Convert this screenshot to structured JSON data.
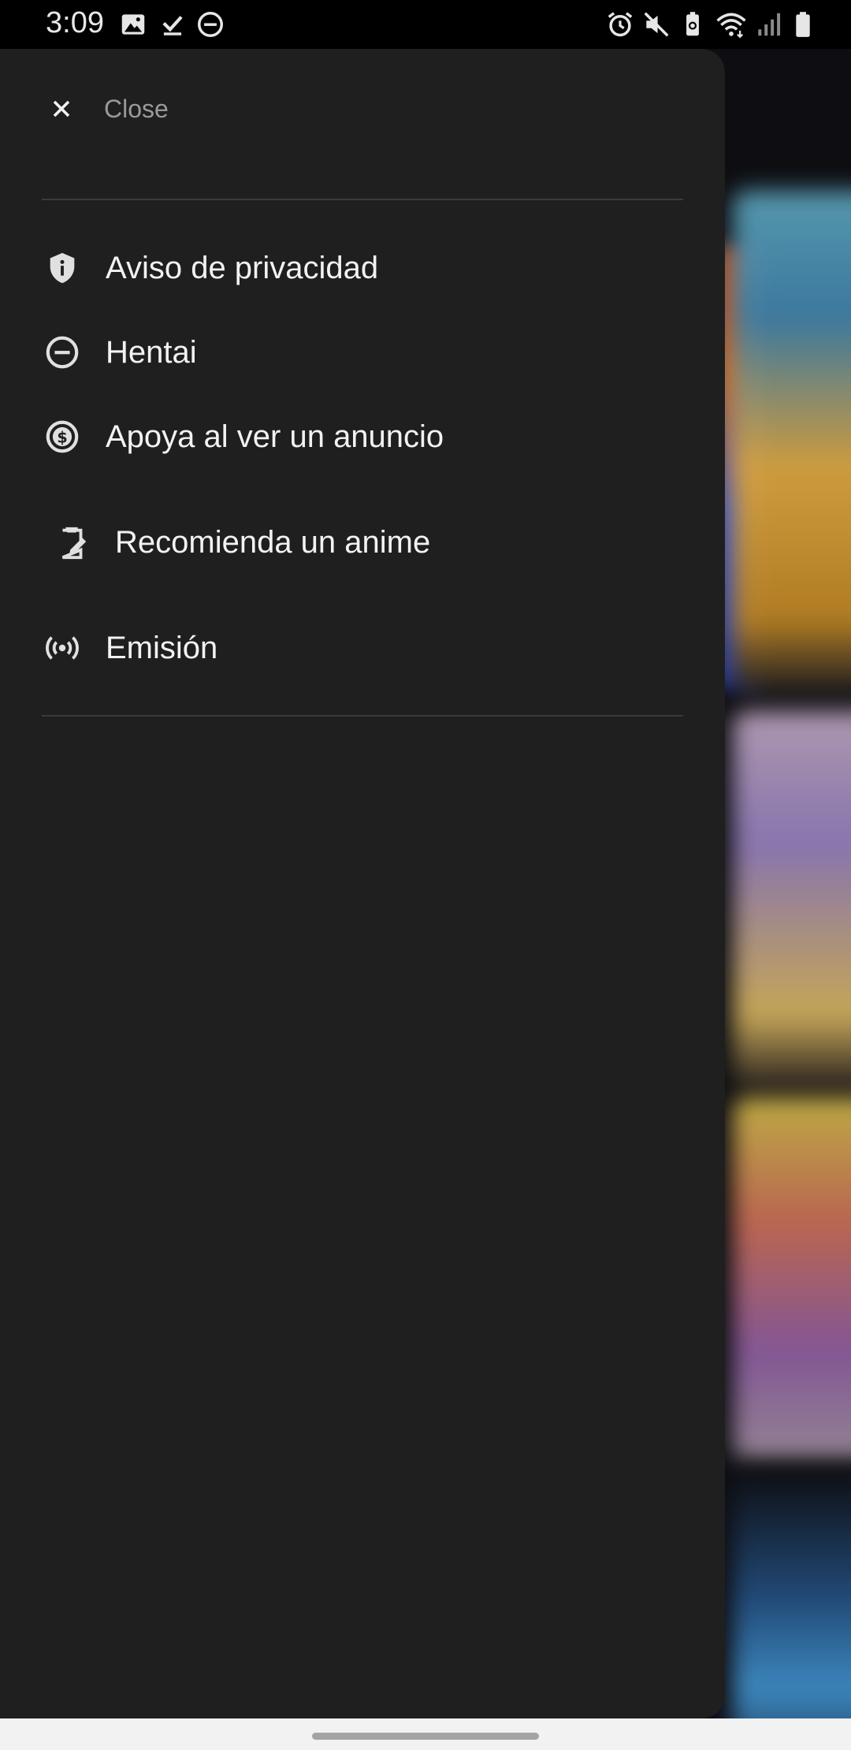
{
  "status_bar": {
    "time": "3:09",
    "left_icons": [
      "image-icon",
      "download-done-icon",
      "do-not-disturb-icon"
    ],
    "right_icons": [
      "alarm-icon",
      "mute-icon",
      "battery-saver-icon",
      "wifi-icon",
      "signal-icon",
      "battery-icon"
    ]
  },
  "drawer": {
    "close_label": "Close",
    "items": [
      {
        "label": "Aviso de privacidad",
        "icon": "shield-info-icon"
      },
      {
        "label": "Hentai",
        "icon": "minus-circle-icon"
      },
      {
        "label": "Apoya al ver un anuncio",
        "icon": "dollar-circle-icon"
      },
      {
        "label": "Recomienda un anime",
        "icon": "clipboard-edit-icon"
      },
      {
        "label": "Emisión",
        "icon": "broadcast-icon"
      }
    ]
  },
  "colors": {
    "drawer_background": "#1f1f1f",
    "status_bar_background": "#000000",
    "text_primary": "#f2f2f2",
    "text_muted": "#9a9a9a"
  }
}
